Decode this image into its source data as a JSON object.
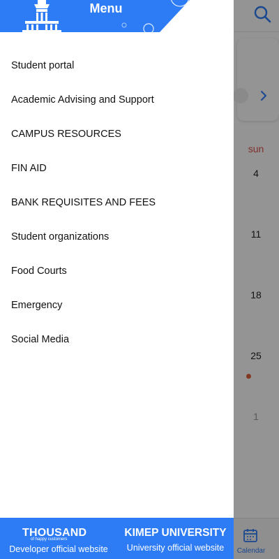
{
  "colors": {
    "brand_blue": "#2d7cf6",
    "footer_blue": "#2d7cf6",
    "sunday_red": "#d9534f",
    "event_dot": "#e0633a",
    "scrim": "rgba(0,0,0,0.42)"
  },
  "drawer": {
    "title": "Menu",
    "logo_icon": "university-building-icon",
    "items": [
      {
        "label": "Student portal"
      },
      {
        "label": "Academic Advising and Support"
      },
      {
        "label": "CAMPUS RESOURCES"
      },
      {
        "label": "FIN AID"
      },
      {
        "label": "BANK REQUISITES AND FEES"
      },
      {
        "label": "Student organizations"
      },
      {
        "label": "Food Courts"
      },
      {
        "label": "Emergency"
      },
      {
        "label": "Social Media"
      }
    ],
    "footer": {
      "developer": {
        "logo_text": "THOUSAND",
        "tagline": "of happy customers",
        "link_label": "Developer official website"
      },
      "university": {
        "logo_text": "KIMEP UNIVERSITY",
        "link_label": "University official website"
      }
    }
  },
  "background": {
    "search_icon": "search-icon",
    "chevron_icon": "chevron-right-icon",
    "weekday_header": "sun",
    "days": [
      "4",
      "11",
      "18",
      "25",
      "1"
    ],
    "bottom_nav": {
      "calendar_label": "Calendar",
      "calendar_icon": "calendar-icon"
    }
  }
}
